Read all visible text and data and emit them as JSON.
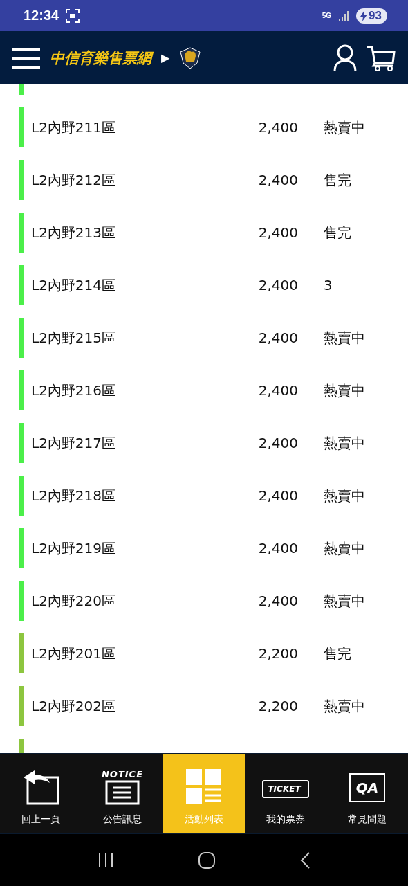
{
  "status_bar": {
    "time": "12:34",
    "network": "5G",
    "battery": "93"
  },
  "header": {
    "title": "中信育樂售票網",
    "arrow": "▶"
  },
  "rows": [
    {
      "color": "#4cef4a"
    },
    {
      "name": "L2內野211區",
      "price": "2,400",
      "status": "熱賣中",
      "color": "#4cef4a"
    },
    {
      "name": "L2內野212區",
      "price": "2,400",
      "status": "售完",
      "color": "#4cef4a"
    },
    {
      "name": "L2內野213區",
      "price": "2,400",
      "status": "售完",
      "color": "#4cef4a"
    },
    {
      "name": "L2內野214區",
      "price": "2,400",
      "status": "3",
      "color": "#4cef4a"
    },
    {
      "name": "L2內野215區",
      "price": "2,400",
      "status": "熱賣中",
      "color": "#4cef4a"
    },
    {
      "name": "L2內野216區",
      "price": "2,400",
      "status": "熱賣中",
      "color": "#4cef4a"
    },
    {
      "name": "L2內野217區",
      "price": "2,400",
      "status": "熱賣中",
      "color": "#4cef4a"
    },
    {
      "name": "L2內野218區",
      "price": "2,400",
      "status": "熱賣中",
      "color": "#4cef4a"
    },
    {
      "name": "L2內野219區",
      "price": "2,400",
      "status": "熱賣中",
      "color": "#4cef4a"
    },
    {
      "name": "L2內野220區",
      "price": "2,400",
      "status": "熱賣中",
      "color": "#4cef4a"
    },
    {
      "name": "L2內野201區",
      "price": "2,200",
      "status": "售完",
      "color": "#8dc63f"
    },
    {
      "name": "L2內野202區",
      "price": "2,200",
      "status": "熱賣中",
      "color": "#8dc63f"
    },
    {
      "color": "#8dc63f"
    }
  ],
  "bottom_nav": [
    {
      "kind": "back",
      "label": "回上一頁",
      "selected": false
    },
    {
      "kind": "notice",
      "label": "公告訊息",
      "badge": "NOTICE",
      "selected": false
    },
    {
      "kind": "list",
      "label": "活動列表",
      "selected": true
    },
    {
      "kind": "ticket",
      "label": "我的票券",
      "badge": "TICKET",
      "selected": false
    },
    {
      "kind": "qa",
      "label": "常見問題",
      "badge": "QA",
      "selected": false
    }
  ]
}
